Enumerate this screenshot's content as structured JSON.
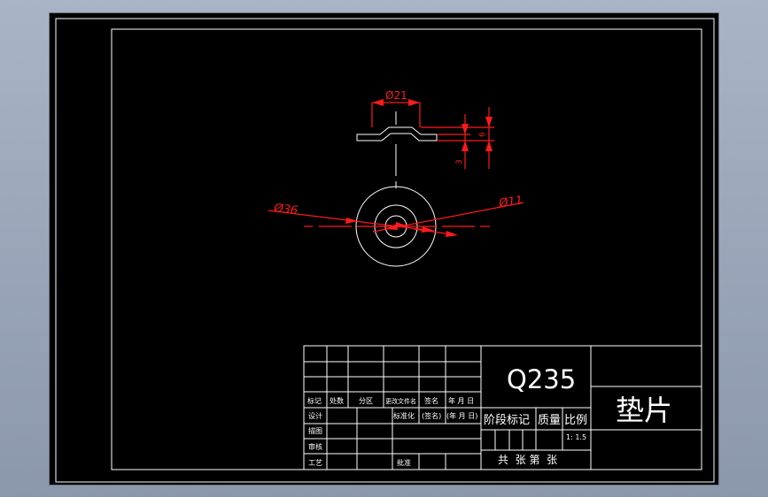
{
  "drawing": {
    "material": "Q235",
    "part_name": "垫片",
    "scale_value": "1: 1.5",
    "dimensions": {
      "outer_diameter": "Ø36",
      "inner_diameter": "Ø11",
      "raised_diameter": "Ø21",
      "thickness": "3",
      "height": "6"
    },
    "title_block": {
      "mark": "标记",
      "count": "处数",
      "zone": "分区",
      "change_doc": "更改文件名",
      "signature": "签名",
      "date": "年 月 日",
      "design": "设计",
      "standardize": "标准化",
      "sign2": "(签名)",
      "date2": "(年 月 日)",
      "drafter": "描图",
      "review": "审核",
      "process": "工艺",
      "approve": "批准",
      "stage_mark": "阶段标记",
      "mass": "质量",
      "scale": "比例",
      "sheet_total": "共  张 第  张"
    }
  }
}
